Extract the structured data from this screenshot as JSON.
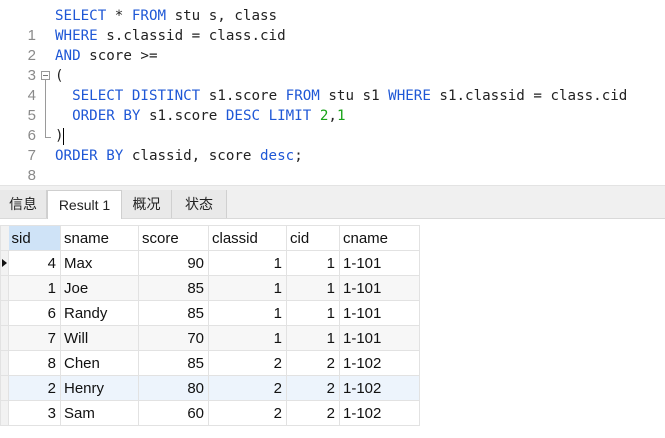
{
  "editor": {
    "lines": [
      {
        "n": "1"
      },
      {
        "n": "2"
      },
      {
        "n": "3"
      },
      {
        "n": "4"
      },
      {
        "n": "5"
      },
      {
        "n": "6"
      },
      {
        "n": "7"
      },
      {
        "n": "8"
      }
    ],
    "tokens": {
      "l1_select": "SELECT",
      "l1_rest": " * ",
      "l1_from": "FROM",
      "l1_tail": " stu s, class",
      "l2_where": "WHERE",
      "l2_tail": " s.classid = class.cid",
      "l3_and": "AND",
      "l3_tail": " score >=",
      "l4_paren": "(",
      "l5_select": "SELECT",
      "l5_distinct": "DISTINCT",
      "l5_col": " s1.score ",
      "l5_from": "FROM",
      "l5_tbl": " stu s1 ",
      "l5_where": "WHERE",
      "l5_cond": " s1.classid = class.cid",
      "l6_order": "ORDER BY",
      "l6_col": " s1.score ",
      "l6_desc": "DESC",
      "l6_sp": " ",
      "l6_limit": "LIMIT",
      "l6_sp2": " ",
      "l6_n1": "2",
      "l6_comma": ",",
      "l6_n2": "1",
      "l7_paren": ")",
      "l8_order": "ORDER BY",
      "l8_cols": " classid, score ",
      "l8_desc": "desc",
      "l8_semi": ";"
    },
    "colors": {
      "keyword": "#1e57d6",
      "number": "#18a318",
      "text": "#222222"
    }
  },
  "tabs": [
    {
      "label": "信息"
    },
    {
      "label": "Result 1"
    },
    {
      "label": "概况"
    },
    {
      "label": "状态"
    }
  ],
  "grid": {
    "columns": [
      "sid",
      "sname",
      "score",
      "classid",
      "cid",
      "cname"
    ],
    "rows": [
      [
        "4",
        "Max",
        "90",
        "1",
        "1",
        "1-101"
      ],
      [
        "1",
        "Joe",
        "85",
        "1",
        "1",
        "1-101"
      ],
      [
        "6",
        "Randy",
        "85",
        "1",
        "1",
        "1-101"
      ],
      [
        "7",
        "Will",
        "70",
        "1",
        "1",
        "1-101"
      ],
      [
        "8",
        "Chen",
        "85",
        "2",
        "2",
        "1-102"
      ],
      [
        "2",
        "Henry",
        "80",
        "2",
        "2",
        "1-102"
      ],
      [
        "3",
        "Sam",
        "60",
        "2",
        "2",
        "1-102"
      ]
    ]
  }
}
